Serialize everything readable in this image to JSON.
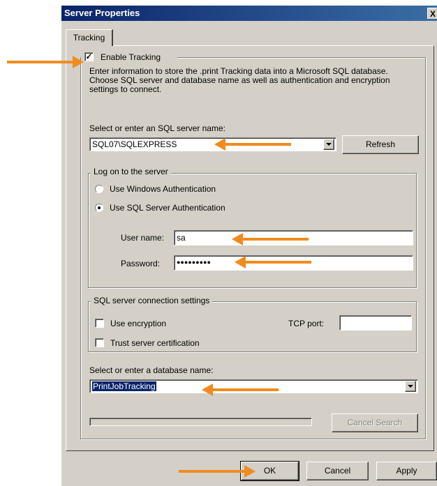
{
  "window": {
    "title": "Server Properties",
    "close_label": "X"
  },
  "tabs": [
    {
      "label": "Tracking"
    }
  ],
  "tracking": {
    "enable_label": "Enable Tracking",
    "enable_checked": true,
    "description": "Enter information to store the .print Tracking data into a Microsoft SQL database. Choose SQL server and database name as well as authentication and encryption settings to connect.",
    "server_label": "Select or enter an SQL server name:",
    "server_value": "SQL07\\SQLEXPRESS",
    "refresh_label": "Refresh"
  },
  "logon": {
    "legend": "Log on to the server",
    "windows_auth_label": "Use Windows Authentication",
    "sql_auth_label": "Use SQL Server Authentication",
    "selected": "sql",
    "username_label": "User name:",
    "username_value": "sa",
    "password_label": "Password:",
    "password_mask": "●●●●●●●●●"
  },
  "connection": {
    "legend": "SQL server connection settings",
    "use_encryption_label": "Use encryption",
    "trust_cert_label": "Trust server certification",
    "tcp_port_label": "TCP port:",
    "tcp_port_value": ""
  },
  "database": {
    "label": "Select or enter a database name:",
    "value": "PrintJobTracking",
    "cancel_search_label": "Cancel Search"
  },
  "footer": {
    "ok_label": "OK",
    "cancel_label": "Cancel",
    "apply_label": "Apply"
  },
  "annotations": {
    "arrow_color": "#f28b1e"
  }
}
